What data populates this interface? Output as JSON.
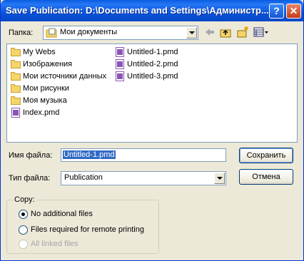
{
  "window": {
    "title": "Save Publication: D:\\Documents and Settings\\Администр...",
    "help_button": "?",
    "close_button": "✕"
  },
  "lookin": {
    "label": "Папка:",
    "value": "Мои документы"
  },
  "files": {
    "column1": [
      {
        "name": "My Webs",
        "icon": "folder-icon"
      },
      {
        "name": "Изображения",
        "icon": "folder-icon"
      },
      {
        "name": "Мои источники данных",
        "icon": "folder-icon"
      },
      {
        "name": "Мои рисунки",
        "icon": "folder-icon"
      },
      {
        "name": "Моя музыка",
        "icon": "folder-icon"
      },
      {
        "name": "Index.pmd",
        "icon": "pmd-file-icon"
      }
    ],
    "column2": [
      {
        "name": "Untitled-1.pmd",
        "icon": "pmd-file-icon"
      },
      {
        "name": "Untitled-2.pmd",
        "icon": "pmd-file-icon"
      },
      {
        "name": "Untitled-3.pmd",
        "icon": "pmd-file-icon"
      }
    ]
  },
  "filename": {
    "label": "Имя файла:",
    "value": "Untitled-1.pmd"
  },
  "filetype": {
    "label": "Тип файла:",
    "value": "Publication"
  },
  "buttons": {
    "save": "Сохранить",
    "cancel": "Отмена"
  },
  "copy": {
    "legend": "Copy:",
    "options": [
      {
        "label": "No additional files",
        "checked": true,
        "enabled": true
      },
      {
        "label": "Files required for remote printing",
        "checked": false,
        "enabled": true
      },
      {
        "label": "All linked files",
        "checked": false,
        "enabled": false
      }
    ]
  },
  "colors": {
    "title_bar": "#0a55dd",
    "selection": "#316ac5",
    "dialog_bg": "#ece9d8"
  }
}
